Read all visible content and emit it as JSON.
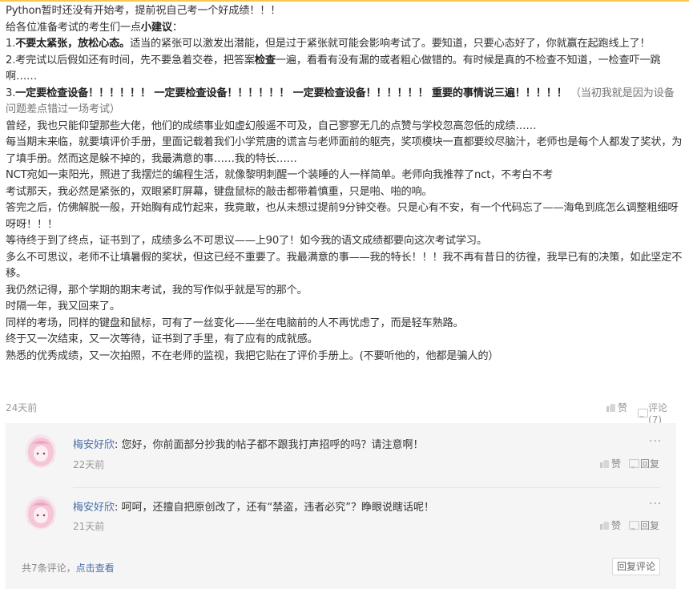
{
  "post": {
    "lines": [
      "Python暂时还没有开始考，提前祝自己考一个好成绩！！！",
      "给各位准备考试的考生们一点",
      "小建议",
      "：",
      "1.",
      "不要太紧张，放松心态。",
      "适当的紧张可以激发出潜能，但是过于紧张就可能会影响考试了。要知道，只要心态好了，你就赢在起跑线上了！",
      "2.考完试以后假如还有时间，先不要急着交卷，把答案",
      "检查",
      "一遍，看看有没有漏的或者粗心做错的。有时候是真的不检查不知道，一检查吓一跳啊……",
      "3.",
      "一定要检查设备！！！！！！ 一定要检查设备！！！！！！ 一定要检查设备！！！！！！ 重要的事情说三遍！！！！！",
      "（当初我就是因为设备问题差点错过一场考试）",
      "曾经，我也只能仰望那些大佬，他们的成绩事业如虚幻般遥不可及，自己寥寥无几的点赞与学校忽高忽低的成绩……",
      "每当期末来临，就要填评价手册，里面记载着我们小学荒唐的谎言与老师面前的躯壳，奖项模块一直都要绞尽脑汁，老师也是每个人都发了奖状，为了填手册。然而这是躲不掉的，我最满意的事……我的特长……",
      "NCT宛如一束阳光，照进了我摆烂的编程生活，就像黎明刺醒一个装睡的人一样简单。老师向我推荐了nct，不考白不考",
      "考试那天，我必然是紧张的，双眼紧盯屏幕，键盘鼠标的敲击都带着慎重，只是啪、啪的响。",
      "答完之后，仿佛解脱一般，开始胸有成竹起来，我竟敢，也从未想过提前9分钟交卷。只是心有不安，有一个代码忘了——海龟到底怎么调整粗细呀呀呀！！！",
      "等待终于到了终点，证书到了，成绩多么不可思议——上90了！如今我的语文成绩都要向这次考试学习。",
      "多么不可思议，老师不让填暑假的奖状，但这已经不重要了。我最满意的事——我的特长！！！我不再有昔日的彷徨，我早已有的决策，如此坚定不移。",
      "我仍然记得，那个学期的期末考试，我的写作似乎就是写的那个。",
      "时隔一年，我又回来了。",
      "同样的考场，同样的键盘和鼠标，可有了一丝变化——坐在电脑前的人不再忧虑了，而是轻车熟路。",
      "终于又一次结束，又一次等待，证书到了手里，有了应有的成就感。",
      "熟悉的优秀成绩，又一次拍照，不在老师的监视，我把它贴在了评价手册上。(不要听他的，他都是骗人的）"
    ]
  },
  "meta": {
    "time": "24天前",
    "like_label": "赞",
    "comment_label": "评论(7)"
  },
  "comments": [
    {
      "author": "梅安好欣",
      "sep": ":",
      "text": "您好，你前面部分抄我的帖子都不跟我打声招呼的吗？请注意啊！",
      "time": "22天前",
      "like_label": "赞",
      "reply_label": "回复",
      "more": "···"
    },
    {
      "author": "梅安好欣",
      "sep": ":",
      "text": "呵呵，还擅自把原创改了，还有“禁盗，违者必究”？睁眼说瞎话呢！",
      "time": "21天前",
      "like_label": "赞",
      "reply_label": "回复",
      "more": "···"
    }
  ],
  "footer": {
    "count_text": "共7条评论，",
    "view_link": "点击查看",
    "reply_button": "回复评论"
  },
  "colors": {
    "accent_top": "#f6c94a",
    "link": "#4a6fa5",
    "comment_bg": "#f5f5f5"
  }
}
